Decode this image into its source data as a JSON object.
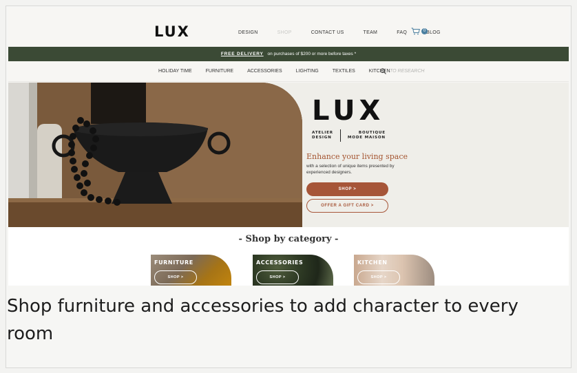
{
  "header": {
    "logo": "LUX",
    "nav": [
      "DESIGN",
      "SHOP",
      "CONTACT US",
      "TEAM",
      "FAQ",
      "BLOG"
    ],
    "active_nav": "SHOP",
    "cart_count": "0"
  },
  "promo": {
    "highlight": "FREE DELIVERY",
    "text": "on purchases of $200 or more before taxes *"
  },
  "category_nav": {
    "items": [
      "HOLIDAY TIME",
      "FURNITURE",
      "ACCESSORIES",
      "LIGHTING",
      "TEXTILES",
      "KITCHEN"
    ],
    "search_placeholder": "TO RESEARCH"
  },
  "hero": {
    "brand": "LUX",
    "sub_left": [
      "ATELIER",
      "DESIGN"
    ],
    "sub_right": [
      "BOUTIQUE",
      "MODE MAISON"
    ],
    "tagline": "Enhance your living space",
    "description": "with a selection of unique items presented by experienced designers.",
    "shop_button": "SHOP >",
    "gift_button": "OFFER A GIFT CARD >"
  },
  "categories": {
    "title": "- Shop by category -",
    "cards": [
      {
        "label": "FURNITURE",
        "button": "SHOP >"
      },
      {
        "label": "ACCESSORIES",
        "button": "SHOP >"
      },
      {
        "label": "KITCHEN",
        "button": "SHOP >"
      }
    ]
  },
  "caption": "Shop furniture and accessories to add character to every room",
  "colors": {
    "promo_bg": "#3b4a35",
    "accent": "#a65538",
    "cart_badge": "#4a7fa0"
  }
}
